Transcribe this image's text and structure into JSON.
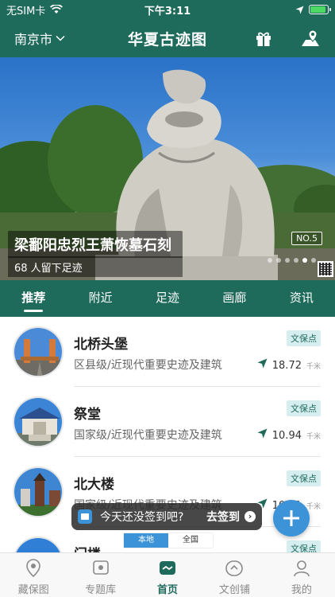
{
  "status_bar": {
    "carrier": "无SIM卡",
    "time": "下午3:11"
  },
  "header": {
    "city": "南京市",
    "title": "华夏古迹图",
    "gift_icon": "gift-icon",
    "map_pin_icon": "map-pin-icon"
  },
  "banner": {
    "title": "梁鄱阳忠烈王萧恢墓石刻",
    "subtitle": "68 人留下足迹",
    "badge": "NO.5",
    "slide_count": 6,
    "active_slide": 5
  },
  "tabs": [
    {
      "label": "推荐",
      "active": true
    },
    {
      "label": "附近",
      "active": false
    },
    {
      "label": "足迹",
      "active": false
    },
    {
      "label": "画廊",
      "active": false
    },
    {
      "label": "资讯",
      "active": false
    }
  ],
  "sites": [
    {
      "name": "北桥头堡",
      "desc": "区县级/近现代重要史迹及建筑",
      "tag": "文保点",
      "distance": "18.72",
      "unit": "千米"
    },
    {
      "name": "祭堂",
      "desc": "国家级/近现代重要史迹及建筑",
      "tag": "文保点",
      "distance": "10.94",
      "unit": "千米"
    },
    {
      "name": "北大楼",
      "desc": "国家级/近现代重要史迹及建筑",
      "tag": "文保点",
      "distance": "10.91",
      "unit": "千米"
    },
    {
      "name": "门楼",
      "desc": "",
      "tag": "文保点",
      "distance": "",
      "unit": ""
    }
  ],
  "signin": {
    "prompt": "今天还没签到吧?",
    "action": "去签到"
  },
  "scope_toggle": {
    "local": "本地",
    "national": "全国"
  },
  "bottom_nav": [
    {
      "label": "藏保图",
      "icon": "map-marker-icon",
      "active": false
    },
    {
      "label": "专题库",
      "icon": "library-icon",
      "active": false
    },
    {
      "label": "首页",
      "icon": "home-icon",
      "active": true
    },
    {
      "label": "文创铺",
      "icon": "shop-icon",
      "active": false
    },
    {
      "label": "我的",
      "icon": "profile-icon",
      "active": false
    }
  ],
  "colors": {
    "brand": "#1e6a5b",
    "accent": "#3d93d8",
    "tag_bg": "#d7eef0"
  }
}
